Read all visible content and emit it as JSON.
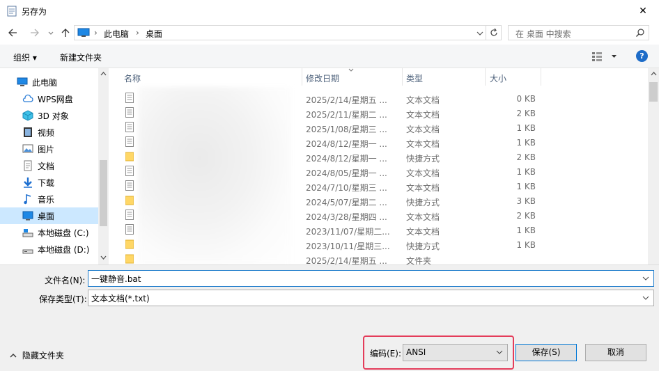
{
  "window": {
    "title": "另存为",
    "close_glyph": "✕"
  },
  "address": {
    "segments": [
      "此电脑",
      "桌面"
    ],
    "search_placeholder": "在 桌面 中搜索"
  },
  "toolbar": {
    "organize_label": "组织 ▾",
    "new_folder_label": "新建文件夹"
  },
  "nav": {
    "items": [
      {
        "label": "此电脑",
        "icon": "computer-icon"
      },
      {
        "label": "WPS网盘",
        "icon": "cloud-icon"
      },
      {
        "label": "3D 对象",
        "icon": "cube-icon"
      },
      {
        "label": "视频",
        "icon": "video-icon"
      },
      {
        "label": "图片",
        "icon": "picture-icon"
      },
      {
        "label": "文档",
        "icon": "document-icon"
      },
      {
        "label": "下载",
        "icon": "download-icon"
      },
      {
        "label": "音乐",
        "icon": "music-icon"
      },
      {
        "label": "桌面",
        "icon": "desktop-icon",
        "selected": true
      },
      {
        "label": "本地磁盘 (C:)",
        "icon": "drive-icon"
      },
      {
        "label": "本地磁盘 (D:)",
        "icon": "drive-icon"
      }
    ]
  },
  "columns": {
    "name": "名称",
    "modified": "修改日期",
    "type": "类型",
    "size": "大小"
  },
  "files": [
    {
      "date": "2025/2/14/星期五 ...",
      "type": "文本文档",
      "size": "0 KB",
      "kind": "doc"
    },
    {
      "date": "2025/2/11/星期二 ...",
      "type": "文本文档",
      "size": "2 KB",
      "kind": "doc"
    },
    {
      "date": "2025/1/08/星期三 ...",
      "type": "文本文档",
      "size": "1 KB",
      "kind": "doc"
    },
    {
      "date": "2024/8/12/星期一 ...",
      "type": "文本文档",
      "size": "1 KB",
      "kind": "doc"
    },
    {
      "date": "2024/8/12/星期一 ...",
      "type": "快捷方式",
      "size": "2 KB",
      "kind": "link"
    },
    {
      "date": "2024/8/05/星期一 ...",
      "type": "文本文档",
      "size": "1 KB",
      "kind": "doc"
    },
    {
      "date": "2024/7/10/星期三 ...",
      "type": "文本文档",
      "size": "1 KB",
      "kind": "doc"
    },
    {
      "date": "2024/5/07/星期二 ...",
      "type": "快捷方式",
      "size": "3 KB",
      "kind": "link"
    },
    {
      "date": "2024/3/28/星期四 ...",
      "type": "文本文档",
      "size": "2 KB",
      "kind": "doc"
    },
    {
      "date": "2023/11/07/星期二...",
      "type": "文本文档",
      "size": "1 KB",
      "kind": "doc"
    },
    {
      "date": "2023/10/11/星期三...",
      "type": "快捷方式",
      "size": "1 KB",
      "kind": "link"
    },
    {
      "date": "2025/2/14/星期五 ...",
      "type": "文件夹",
      "size": "",
      "kind": "folder"
    }
  ],
  "form": {
    "filename_label": "文件名(N):",
    "filename_value": "一键静音.bat",
    "filetype_label": "保存类型(T):",
    "filetype_value": "文本文档(*.txt)",
    "hide_folders_label": "隐藏文件夹",
    "encoding_label": "编码(E):",
    "encoding_value": "ANSI",
    "save_label": "保存(S)",
    "cancel_label": "取消"
  },
  "colors": {
    "accent": "#0078d7",
    "highlight": "#e43c5a",
    "selected": "#cce8ff"
  }
}
